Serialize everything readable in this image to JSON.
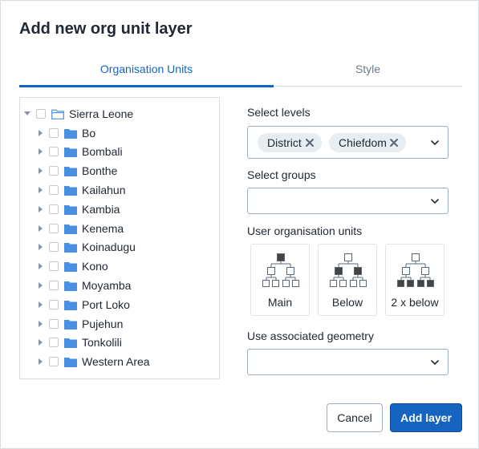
{
  "dialog": {
    "title": "Add new org unit layer"
  },
  "tabs": [
    {
      "label": "Organisation Units",
      "active": true
    },
    {
      "label": "Style",
      "active": false
    }
  ],
  "tree": {
    "root": {
      "label": "Sierra Leone",
      "expanded": true,
      "icon": "folder-open-icon"
    },
    "children": [
      {
        "label": "Bo"
      },
      {
        "label": "Bombali"
      },
      {
        "label": "Bonthe"
      },
      {
        "label": "Kailahun"
      },
      {
        "label": "Kambia"
      },
      {
        "label": "Kenema"
      },
      {
        "label": "Koinadugu"
      },
      {
        "label": "Kono"
      },
      {
        "label": "Moyamba"
      },
      {
        "label": "Port Loko"
      },
      {
        "label": "Pujehun"
      },
      {
        "label": "Tonkolili"
      },
      {
        "label": "Western Area"
      }
    ]
  },
  "levels": {
    "label": "Select levels",
    "selected": [
      "District",
      "Chiefdom"
    ]
  },
  "groups": {
    "label": "Select groups",
    "value": ""
  },
  "user_org_units": {
    "label": "User organisation units",
    "options": [
      {
        "label": "Main",
        "icon": "org-tree-main-icon"
      },
      {
        "label": "Below",
        "icon": "org-tree-below-icon"
      },
      {
        "label": "2 x below",
        "icon": "org-tree-2-below-icon"
      }
    ]
  },
  "geometry": {
    "label": "Use associated geometry",
    "value": ""
  },
  "actions": {
    "cancel": "Cancel",
    "add": "Add layer"
  },
  "colors": {
    "primary": "#1565c0",
    "folder": "#4a90e2",
    "chip_bg": "#e8edf2"
  }
}
